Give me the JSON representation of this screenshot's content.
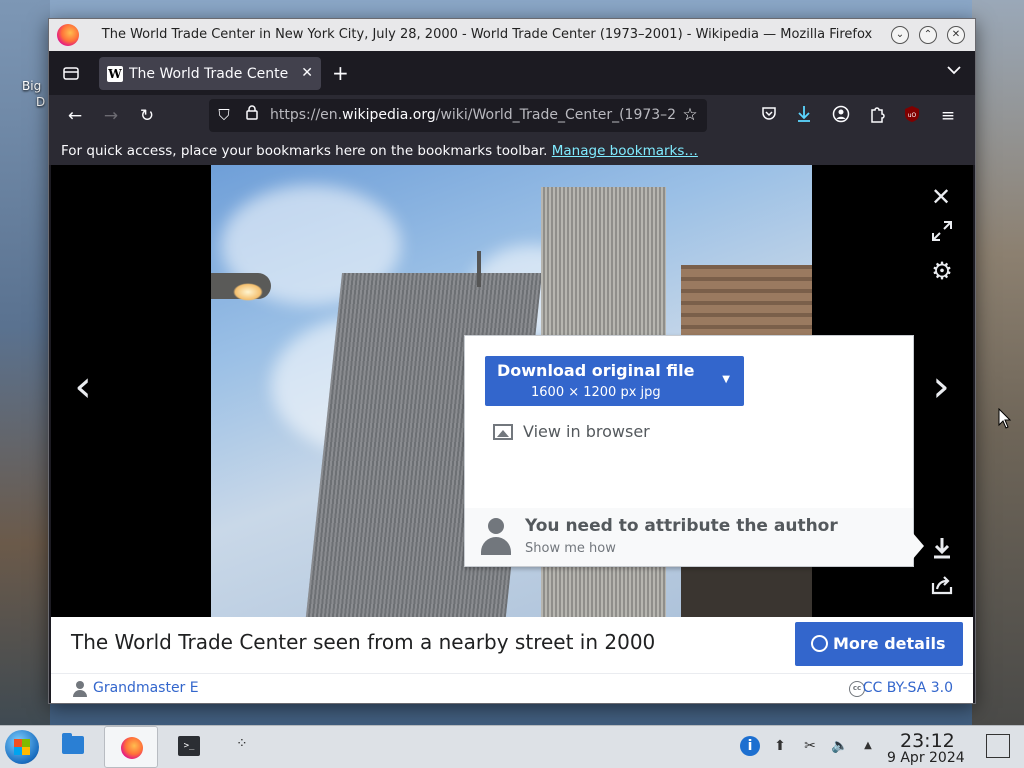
{
  "desktop": {
    "icon_label_line1": "Big",
    "icon_label_line2": "D"
  },
  "window": {
    "title": "The World Trade Center in New York City, July 28, 2000 - World Trade Center (1973–2001) - Wikipedia — Mozilla Firefox"
  },
  "tabs": [
    {
      "title": "The World Trade Center i",
      "favicon": "W"
    }
  ],
  "urlbar": {
    "prefix": "https://en.",
    "domain": "wikipedia.org",
    "path": "/wiki/World_Trade_Center_(1973–2"
  },
  "bookmarks_bar": {
    "text": "For quick access, place your bookmarks here on the bookmarks toolbar.",
    "link": "Manage bookmarks…"
  },
  "download_popup": {
    "button_label": "Download original file",
    "button_sub": "1600 × 1200 px jpg",
    "view_in_browser": "View in browser",
    "attribution_title": "You need to attribute the author",
    "attribution_sub": "Show me how"
  },
  "viewer": {
    "caption": "The World Trade Center seen from a nearby street in 2000",
    "more_details": "More details",
    "author": "Grandmaster E",
    "license": "CC BY-SA 3.0"
  },
  "taskbar": {
    "time": "23:12",
    "date": "9 Apr 2024"
  },
  "colors": {
    "accent": "#3366cc",
    "firefox_dark": "#1c1b22",
    "toolbar": "#2b2a33",
    "link_cyan": "#80ebff"
  }
}
